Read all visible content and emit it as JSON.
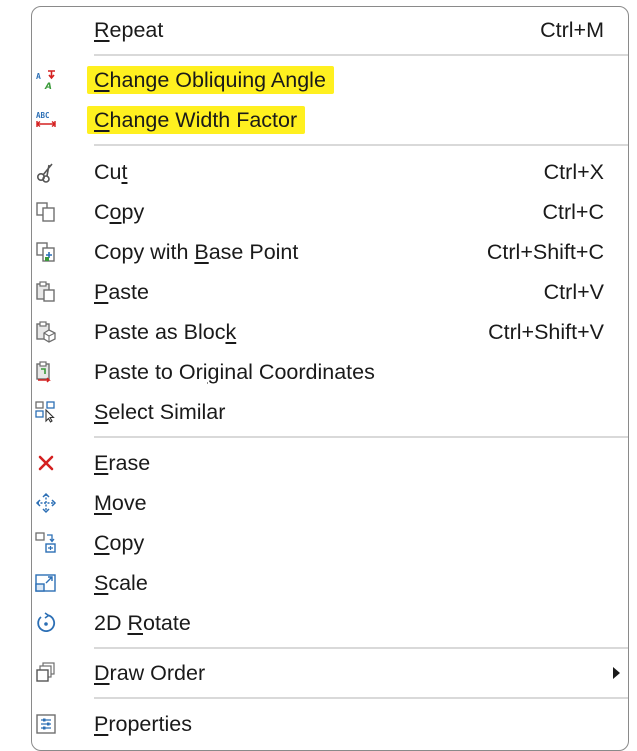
{
  "menu": {
    "items": [
      {
        "id": "repeat",
        "pre": "",
        "ul": "R",
        "post": "epeat",
        "shortcut": "Ctrl+M",
        "icon": "none",
        "highlight": false
      },
      {
        "id": "change-obliquing-angle",
        "pre": "",
        "ul": "C",
        "post": "hange Obliquing Angle",
        "shortcut": "",
        "icon": "obliquing-angle-icon",
        "highlight": true
      },
      {
        "id": "change-width-factor",
        "pre": "",
        "ul": "C",
        "post": "hange Width Factor",
        "shortcut": "",
        "icon": "width-factor-icon",
        "highlight": true
      },
      {
        "id": "cut",
        "pre": "Cu",
        "ul": "t",
        "post": "",
        "shortcut": "Ctrl+X",
        "icon": "scissors-icon",
        "highlight": false
      },
      {
        "id": "copy-clip",
        "pre": "C",
        "ul": "o",
        "post": "py",
        "shortcut": "Ctrl+C",
        "icon": "copy-icon",
        "highlight": false
      },
      {
        "id": "copy-with-base-point",
        "pre": "Copy with ",
        "ul": "B",
        "post": "ase Point",
        "shortcut": "Ctrl+Shift+C",
        "icon": "copy-base-point-icon",
        "highlight": false
      },
      {
        "id": "paste",
        "pre": "",
        "ul": "P",
        "post": "aste",
        "shortcut": "Ctrl+V",
        "icon": "paste-icon",
        "highlight": false
      },
      {
        "id": "paste-as-block",
        "pre": "Paste as Bloc",
        "ul": "k",
        "post": "",
        "shortcut": "Ctrl+Shift+V",
        "icon": "paste-block-icon",
        "highlight": false
      },
      {
        "id": "paste-original-coords",
        "pre": "Paste to Ori",
        "ul": "g",
        "post": "inal Coordinates",
        "shortcut": "",
        "icon": "paste-original-icon",
        "highlight": false
      },
      {
        "id": "select-similar",
        "pre": "",
        "ul": "S",
        "post": "elect Similar",
        "shortcut": "",
        "icon": "select-similar-icon",
        "highlight": false
      },
      {
        "id": "erase",
        "pre": "",
        "ul": "E",
        "post": "rase",
        "shortcut": "",
        "icon": "erase-icon",
        "highlight": false
      },
      {
        "id": "move",
        "pre": "",
        "ul": "M",
        "post": "ove",
        "shortcut": "",
        "icon": "move-icon",
        "highlight": false
      },
      {
        "id": "copy-modify",
        "pre": "",
        "ul": "C",
        "post": "opy",
        "shortcut": "",
        "icon": "copy-objects-icon",
        "highlight": false
      },
      {
        "id": "scale",
        "pre": "",
        "ul": "S",
        "post": "cale",
        "shortcut": "",
        "icon": "scale-icon",
        "highlight": false
      },
      {
        "id": "rotate",
        "pre": "2D ",
        "ul": "R",
        "post": "otate",
        "shortcut": "",
        "icon": "rotate-icon",
        "highlight": false
      },
      {
        "id": "draw-order",
        "pre": "",
        "ul": "D",
        "post": "raw Order",
        "shortcut": "",
        "icon": "draw-order-icon",
        "highlight": false,
        "submenu": true
      },
      {
        "id": "properties",
        "pre": "",
        "ul": "P",
        "post": "roperties",
        "shortcut": "",
        "icon": "properties-icon",
        "highlight": false
      }
    ]
  },
  "colors": {
    "highlight": "#fff01f",
    "erase_red": "#d42020",
    "icon_blue": "#2c6fb5",
    "icon_gray": "#6e6e6e",
    "separator": "#d9d9d9"
  }
}
